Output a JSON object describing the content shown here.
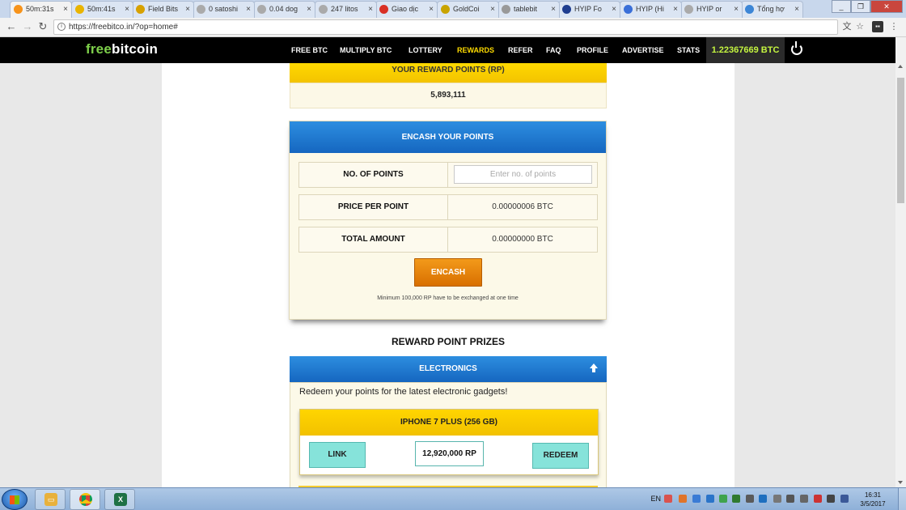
{
  "browser": {
    "tabs": [
      {
        "title": "50m:31s",
        "favicon": "bitcoin-icon",
        "color": "#f7931a"
      },
      {
        "title": "50m:41s",
        "favicon": "bitcoin-icon",
        "color": "#e9b400"
      },
      {
        "title": "Field Bits",
        "favicon": "coin-icon",
        "color": "#d7a100"
      },
      {
        "title": "0 satoshi",
        "favicon": "page-icon",
        "color": "#aaaaaa"
      },
      {
        "title": "0.04 dog",
        "favicon": "page-icon",
        "color": "#aaaaaa"
      },
      {
        "title": "247 litos",
        "favicon": "page-icon",
        "color": "#aaaaaa"
      },
      {
        "title": "Giao dịc",
        "favicon": "gmail-icon",
        "color": "#d93025"
      },
      {
        "title": "GoldCoi",
        "favicon": "gold-icon",
        "color": "#c9a400"
      },
      {
        "title": "tablebit",
        "favicon": "page-icon",
        "color": "#999999"
      },
      {
        "title": "HYIP Fo",
        "favicon": "dollar-icon",
        "color": "#1e3d8f"
      },
      {
        "title": "HYIP (Hi",
        "favicon": "v-icon",
        "color": "#3a6fd8"
      },
      {
        "title": "HYIP or",
        "favicon": "page-icon",
        "color": "#aaaaaa"
      },
      {
        "title": "Tổng hợ",
        "favicon": "globe-icon",
        "color": "#3c86d6"
      }
    ],
    "url": "https://freebitco.in/?op=home#"
  },
  "site": {
    "logo_free": "free",
    "logo_bitcoin": "bitcoin",
    "nav": [
      "FREE BTC",
      "MULTIPLY BTC",
      "LOTTERY",
      "REWARDS",
      "REFER",
      "FAQ",
      "PROFILE",
      "ADVERTISE",
      "STATS"
    ],
    "active_nav": "REWARDS",
    "balance": "1.22367669 BTC"
  },
  "reward_points": {
    "header": "YOUR REWARD POINTS (RP)",
    "value": "5,893,111"
  },
  "encash": {
    "header": "ENCASH YOUR POINTS",
    "no_points_label": "NO. OF POINTS",
    "no_points_placeholder": "Enter no. of points",
    "price_label": "PRICE PER POINT",
    "price_value": "0.00000006 BTC",
    "total_label": "TOTAL AMOUNT",
    "total_value": "0.00000000 BTC",
    "button": "ENCASH",
    "note": "Minimum 100,000 RP have to be exchanged at one time"
  },
  "prizes": {
    "title": "REWARD POINT PRIZES",
    "category": "ELECTRONICS",
    "description": "Redeem your points for the latest electronic gadgets!",
    "item": {
      "name": "IPHONE 7 PLUS (256 GB)",
      "link_label": "LINK",
      "price": "12,920,000 RP",
      "redeem_label": "REDEEM"
    }
  },
  "taskbar": {
    "language": "EN",
    "time": "16:31",
    "date": "3/5/2017"
  },
  "colors": {
    "logo_green": "#7ed04b",
    "active_nav": "#ffdc00",
    "balance_text": "#c4f540",
    "blue_header": "#1f7ad3",
    "yellow_header": "#ffd500",
    "encash_orange": "#e88400",
    "teal_button": "#86e3da"
  }
}
